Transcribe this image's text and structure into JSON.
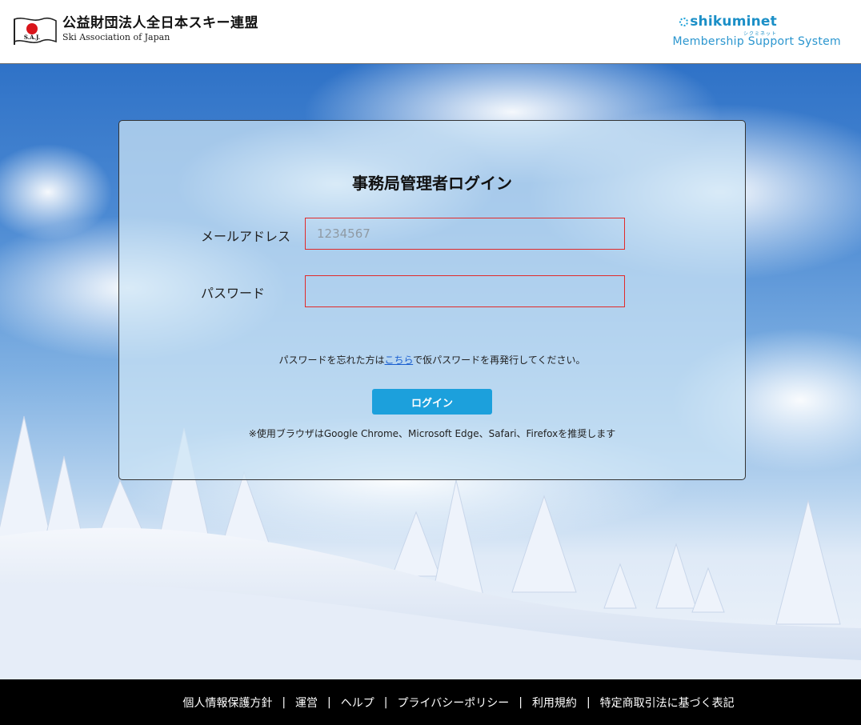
{
  "header": {
    "org_name_jp": "公益財団法人全日本スキー連盟",
    "org_name_en": "Ski Association of Japan",
    "flag_text": "S.A.J.",
    "partner_logo": "shikuminet",
    "partner_logo_kana": "シクミネット",
    "partner_subtitle": "Membership Support System"
  },
  "login": {
    "title": "事務局管理者ログイン",
    "email_label": "メールアドレス",
    "email_placeholder": "1234567",
    "password_label": "パスワード",
    "password_placeholder": "",
    "forgot_prefix": "パスワードを忘れた方は",
    "forgot_link": "こちら",
    "forgot_suffix": "で仮パスワードを再発行してください。",
    "submit_label": "ログイン",
    "browser_note": "※使用ブラウザはGoogle Chrome、Microsoft Edge、Safari、Firefoxを推奨します"
  },
  "footer": {
    "links": [
      {
        "label": "個人情報保護方針"
      },
      {
        "label": "運営"
      },
      {
        "label": "ヘルプ"
      },
      {
        "label": "プライバシーポリシー"
      },
      {
        "label": "利用規約"
      },
      {
        "label": "特定商取引法に基づく表記"
      }
    ],
    "separator": "|"
  },
  "colors": {
    "accent": "#1ca0dc",
    "input_border": "#e12a2a",
    "link": "#1a5fd0",
    "footer_bg": "#000000"
  }
}
